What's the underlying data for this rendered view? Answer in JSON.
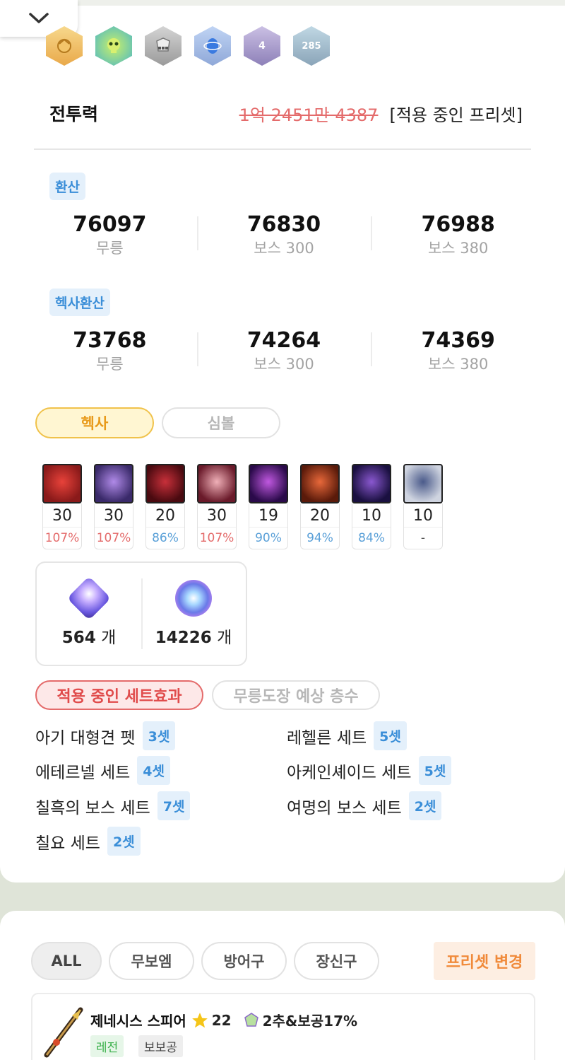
{
  "header": {
    "collapse_icon": "chevron-down-icon",
    "badges": [
      {
        "name": "gold-crest-badge",
        "color": "#f2c16a",
        "label": ""
      },
      {
        "name": "green-skull-badge",
        "color": "#7fd24a",
        "label": ""
      },
      {
        "name": "armor-badge",
        "color": "#a9a9a9",
        "label": ""
      },
      {
        "name": "blue-orb-badge",
        "color": "#7fa4e8",
        "label": ""
      },
      {
        "name": "wizard-hat-badge",
        "color": "#9e8ec4",
        "label": "4"
      },
      {
        "name": "potion-badge",
        "color": "#8bb0c4",
        "label": "285"
      }
    ]
  },
  "combat_power": {
    "label": "전투력",
    "value": "1억 2451만 4387",
    "preset": "[적용 중인 프리셋]"
  },
  "conversion": {
    "tag": "환산",
    "stats": [
      {
        "value": "76097",
        "label": "무릉"
      },
      {
        "value": "76830",
        "label": "보스 300"
      },
      {
        "value": "76988",
        "label": "보스 380"
      }
    ]
  },
  "hexa_conversion": {
    "tag": "헥사환산",
    "stats": [
      {
        "value": "73768",
        "label": "무릉"
      },
      {
        "value": "74264",
        "label": "보스 300"
      },
      {
        "value": "74369",
        "label": "보스 380"
      }
    ]
  },
  "toggle": {
    "hexa": "헥사",
    "symbol": "심볼"
  },
  "skills": [
    {
      "level": "30",
      "percent": "107%",
      "pct_color": "#e46b6b",
      "c1": "#8a1a1a",
      "c2": "#e8423a"
    },
    {
      "level": "30",
      "percent": "107%",
      "pct_color": "#e46b6b",
      "c1": "#3a2a6a",
      "c2": "#b08ae8"
    },
    {
      "level": "20",
      "percent": "86%",
      "pct_color": "#5aa0d8",
      "c1": "#4a0a10",
      "c2": "#c8303a"
    },
    {
      "level": "30",
      "percent": "107%",
      "pct_color": "#e46b6b",
      "c1": "#6a1a2a",
      "c2": "#f0b0b8"
    },
    {
      "level": "19",
      "percent": "90%",
      "pct_color": "#5aa0d8",
      "c1": "#2a0a4a",
      "c2": "#c058e0"
    },
    {
      "level": "20",
      "percent": "94%",
      "pct_color": "#5aa0d8",
      "c1": "#5a1a0a",
      "c2": "#e8683a"
    },
    {
      "level": "10",
      "percent": "84%",
      "pct_color": "#5aa0d8",
      "c1": "#1a1040",
      "c2": "#8a58d0"
    },
    {
      "level": "10",
      "percent": "-",
      "pct_color": "#555555",
      "c1": "#cfd4e0",
      "c2": "#4a5a8a"
    }
  ],
  "fragments": [
    {
      "count": "564",
      "unit": "개",
      "icon": "crystal-fragment-icon"
    },
    {
      "count": "14226",
      "unit": "개",
      "icon": "swirl-orb-icon"
    }
  ],
  "set_tabs": {
    "active": "적용 중인 세트효과",
    "inactive": "무릉도장 예상 층수"
  },
  "sets": [
    {
      "name": "아기 대형견 펫",
      "count": "3셋"
    },
    {
      "name": "레헬른 세트",
      "count": "5셋"
    },
    {
      "name": "에테르넬 세트",
      "count": "4셋"
    },
    {
      "name": "아케인셰이드 세트",
      "count": "5셋"
    },
    {
      "name": "칠흑의 보스 세트",
      "count": "7셋"
    },
    {
      "name": "여명의 보스 세트",
      "count": "2셋"
    },
    {
      "name": "칠요 세트",
      "count": "2셋"
    }
  ],
  "filters": {
    "all": "ALL",
    "weapon": "무보엠",
    "armor": "방어구",
    "accessory": "장신구",
    "preset_change": "프리셋 변경"
  },
  "item": {
    "name": "제네시스 스피어",
    "stars": "22",
    "potential": "2추&보공17%",
    "grade": "레전",
    "tag": "보보공"
  }
}
